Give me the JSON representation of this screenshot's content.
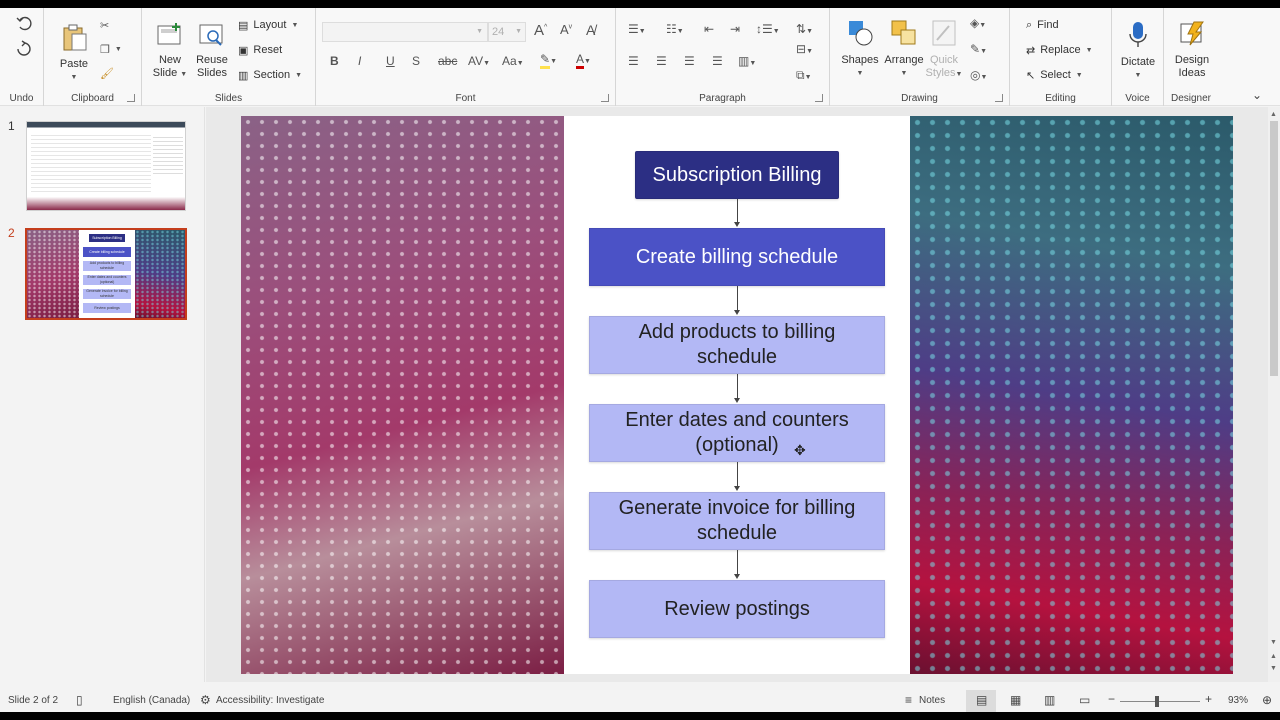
{
  "ribbon": {
    "undo": {
      "label": "Undo"
    },
    "clipboard": {
      "label": "Clipboard",
      "paste": "Paste"
    },
    "slides": {
      "label": "Slides",
      "new_slide": "New",
      "new_slide_2": "Slide",
      "reuse": "Reuse",
      "reuse_2": "Slides",
      "layout": "Layout",
      "reset": "Reset",
      "section": "Section"
    },
    "font": {
      "label": "Font",
      "font_name": "",
      "font_size": "24"
    },
    "paragraph": {
      "label": "Paragraph"
    },
    "drawing": {
      "label": "Drawing",
      "shapes": "Shapes",
      "arrange": "Arrange",
      "quick_styles": "Quick",
      "quick_styles_2": "Styles"
    },
    "editing": {
      "label": "Editing",
      "find": "Find",
      "replace": "Replace",
      "select": "Select"
    },
    "voice": {
      "label": "Voice",
      "dictate": "Dictate"
    },
    "designer": {
      "label": "Designer",
      "design_ideas": "Design",
      "design_ideas_2": "Ideas"
    }
  },
  "thumbnails": [
    {
      "number": "1",
      "active": false
    },
    {
      "number": "2",
      "active": true,
      "mini_title": "Subscription Billing",
      "mini_steps": [
        "Create billing schedule",
        "Add products to billing schedule",
        "Enter dates and counters (optional)",
        "Generate invoice for billing schedule",
        "Review postings"
      ]
    }
  ],
  "slide": {
    "title": "Subscription Billing",
    "steps": [
      {
        "text": "Create billing schedule",
        "style": "blue"
      },
      {
        "text": "Add products to billing schedule",
        "style": "light"
      },
      {
        "text": "Enter dates and counters (optional)",
        "style": "light"
      },
      {
        "text": "Generate invoice for billing schedule",
        "style": "light"
      },
      {
        "text": "Review postings",
        "style": "light"
      }
    ]
  },
  "statusbar": {
    "slide_count": "Slide 2 of 2",
    "language": "English (Canada)",
    "accessibility": "Accessibility: Investigate",
    "notes": "Notes",
    "zoom": "93%"
  },
  "colors": {
    "title_box": "#2c2f84",
    "step_blue": "#4b52c6",
    "step_light": "#b3b8f5",
    "active_thumb_border": "#c43e1c"
  }
}
